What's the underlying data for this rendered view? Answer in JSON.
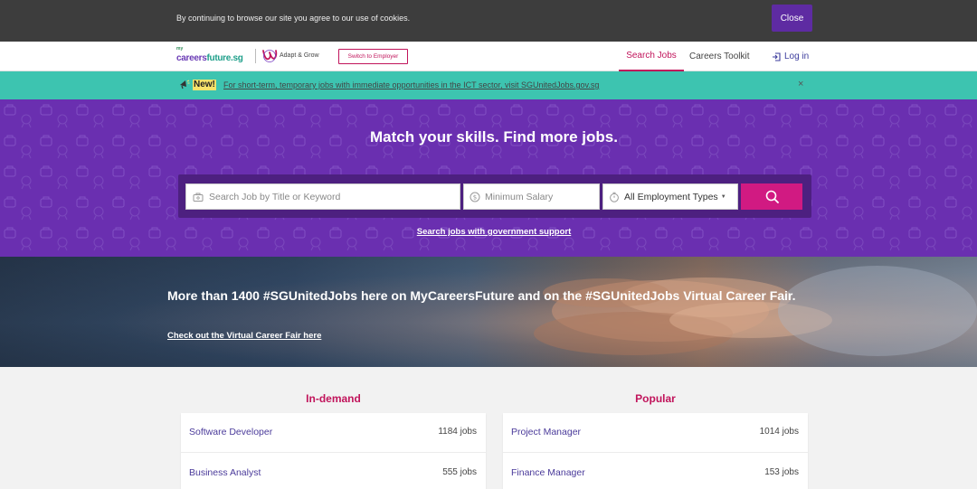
{
  "cookie": {
    "text": "By continuing to browse our site you agree to our use of cookies.",
    "close_label": "Close"
  },
  "header": {
    "logo_my": "my",
    "logo_careers": "careers",
    "logo_future": "future.sg",
    "adapt_label": "Adapt & Grow",
    "switch_label": "Switch to Employer",
    "nav": {
      "search_jobs": "Search Jobs",
      "careers_toolkit": "Careers Toolkit",
      "login": "Log in"
    }
  },
  "announcement": {
    "badge": "New!",
    "text": "For short-term, temporary jobs with immediate opportunities in the ICT sector, visit SGUnitedJobs.gov.sg",
    "close": "×"
  },
  "hero": {
    "title": "Match your skills. Find more jobs.",
    "search_placeholder": "Search Job by Title or Keyword",
    "salary_placeholder": "Minimum Salary",
    "employment_type": "All Employment Types",
    "gov_link": "Search jobs with government support"
  },
  "banner": {
    "title": "More than 1400 #SGUnitedJobs here on MyCareersFuture and on the #SGUnitedJobs Virtual Career Fair.",
    "link": "Check out the Virtual Career Fair here"
  },
  "lists": {
    "in_demand": {
      "title": "In-demand",
      "items": [
        {
          "name": "Software Developer",
          "count": "1184 jobs"
        },
        {
          "name": "Business Analyst",
          "count": "555 jobs"
        }
      ]
    },
    "popular": {
      "title": "Popular",
      "items": [
        {
          "name": "Project Manager",
          "count": "1014 jobs"
        },
        {
          "name": "Finance Manager",
          "count": "153 jobs"
        }
      ]
    }
  },
  "colors": {
    "brand_purple": "#6a2fb0",
    "accent_pink": "#c1145b",
    "search_button": "#d11a82",
    "teal": "#3dc4b0"
  }
}
